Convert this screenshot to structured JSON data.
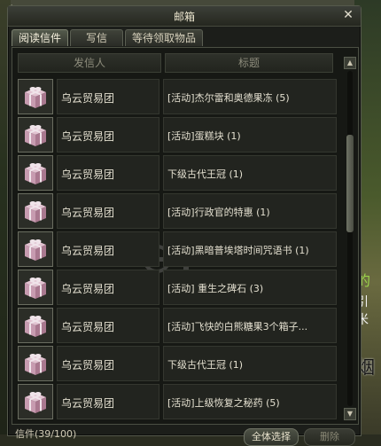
{
  "background": {
    "top_text": "…",
    "right_text_a": "的",
    "right_text_b": "引 米",
    "right_text_c": "烟"
  },
  "window": {
    "title": "邮箱",
    "close_label": "✕"
  },
  "tabs": [
    {
      "label": "阅读信件",
      "active": true
    },
    {
      "label": "写信",
      "active": false
    },
    {
      "label": "等待领取物品",
      "active": false
    }
  ],
  "columns": {
    "sender": "发信人",
    "subject": "标题"
  },
  "mails": [
    {
      "sender": "乌云贸易团",
      "subject": "[活动]杰尔雷和奥德果冻 (5)"
    },
    {
      "sender": "乌云贸易团",
      "subject": "[活动]蛋糕块 (1)"
    },
    {
      "sender": "乌云贸易团",
      "subject": "下级古代王冠 (1)"
    },
    {
      "sender": "乌云贸易团",
      "subject": "[活动]行政官的特惠 (1)"
    },
    {
      "sender": "乌云贸易团",
      "subject": "[活动]黑暗普埃塔时间咒语书 (1)"
    },
    {
      "sender": "乌云贸易团",
      "subject": "[活动] 重生之碑石 (3)"
    },
    {
      "sender": "乌云贸易团",
      "subject": "[活动]飞快的白熊糖果3个箱子..."
    },
    {
      "sender": "乌云贸易团",
      "subject": "下级古代王冠 (1)"
    },
    {
      "sender": "乌云贸易团",
      "subject": "[活动]上级恢复之秘药 (5)"
    }
  ],
  "footer": {
    "mail_count": "信件(39/100)",
    "select_all": "全体选择",
    "delete": "删除"
  },
  "icons": {
    "gift": "gift-box-icon",
    "scroll_up": "triangle-up-icon",
    "scroll_down": "triangle-down-icon"
  },
  "colors": {
    "gift_pink": "#c79bb0",
    "gift_ribbon": "#f0e4ea",
    "panel_bg": "#161814"
  }
}
